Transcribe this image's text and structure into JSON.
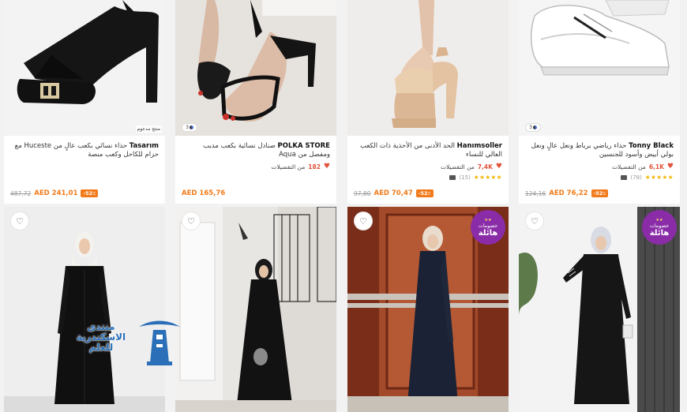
{
  "products": [
    {
      "brand": "Tasarım",
      "title": "حذاء نسائي بكعب عالٍ من Huceste مع حزام للكاحل وكعب منصة",
      "tag": "منتج مدعوم",
      "discount": "-52٪",
      "price": "AED 241,01",
      "old_price": "487,72"
    },
    {
      "brand": "POLKA STORE",
      "title": "صنادل نسائية بكعب مدبب ومفصل من Aqua",
      "chip": "3",
      "fav_count": "182",
      "fav_label": "من التفضيلات",
      "price": "AED 165,76"
    },
    {
      "brand": "Hanımsoller",
      "title": "الحد الأدنى من الأحذية ذات الكعب العالي للنساء",
      "fav_count": "7,4K",
      "fav_label": "من التفضيلات",
      "stars": "★★★★★",
      "rating_count": "(15)",
      "discount": "-52٪",
      "price": "AED 70,47",
      "old_price": "97,80"
    },
    {
      "brand": "Tonny Black",
      "title": "حذاء رياضي برباط ونعل عالٍ ونعل بولي أبيض وأسود للجنسين",
      "chip": "3",
      "fav_count": "6,1K",
      "fav_label": "من التفضيلات",
      "stars": "★★★★★",
      "rating_count": "(78)",
      "discount": "-52٪",
      "price": "AED 76,22",
      "old_price": "124,16"
    }
  ],
  "badge": {
    "line1": "خصومات",
    "line2": "هائلة",
    "stars": "★★"
  },
  "watermark": {
    "line1": "منتدى",
    "line2": "الاسكندرية",
    "line3": "للعلم"
  },
  "icons": {
    "favorite": "heart-icon",
    "color_chip": "color-swatch-icon",
    "rating": "camera-icon"
  },
  "colors": {
    "accent": "#f27a1a",
    "badge": "#8a2ca8",
    "heart": "#e0533a"
  }
}
